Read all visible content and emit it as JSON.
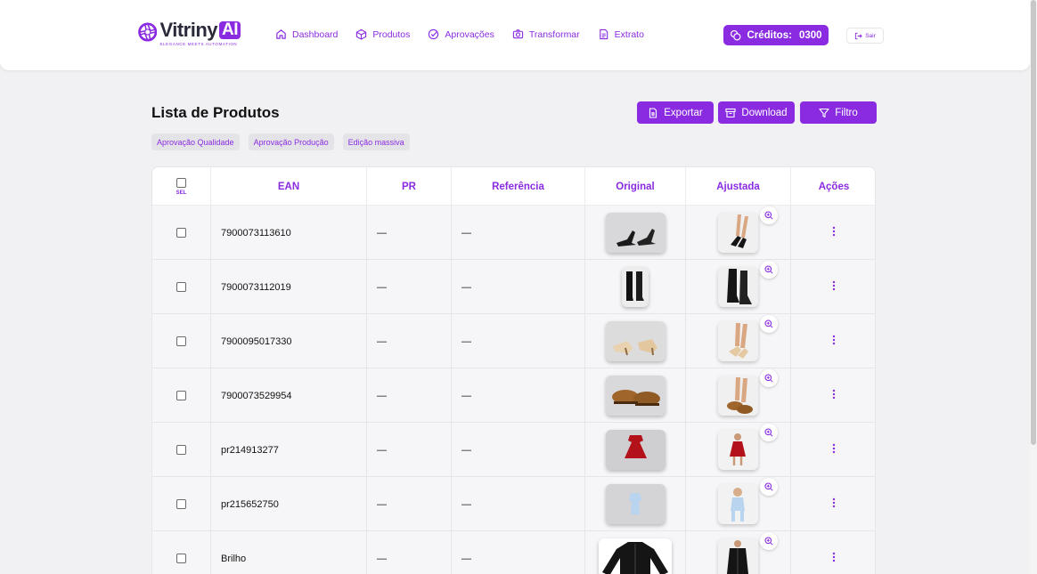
{
  "brand": {
    "word": "Vitriny",
    "ai": "AI",
    "tagline": "ELEGANCE MEETS AUTOMATION",
    "color": "#8a2be2"
  },
  "nav": [
    {
      "label": "Dashboard",
      "icon": "home-icon"
    },
    {
      "label": "Produtos",
      "icon": "box-icon"
    },
    {
      "label": "Aprovações",
      "icon": "check-circle-icon"
    },
    {
      "label": "Transformar",
      "icon": "camera-icon"
    },
    {
      "label": "Extrato",
      "icon": "document-icon"
    }
  ],
  "credits": {
    "label": "Créditos:",
    "value": "0300"
  },
  "logout": {
    "label": "Sair"
  },
  "page": {
    "title": "Lista de Produtos",
    "actions": {
      "export": "Exportar",
      "download": "Download",
      "filter": "Filtro"
    },
    "chips": [
      "Aprovação Qualidade",
      "Aprovação Produção",
      "Edição massiva"
    ]
  },
  "table": {
    "columns": {
      "sel": "SEL",
      "ean": "EAN",
      "pr": "PR",
      "ref": "Referência",
      "original": "Original",
      "adjusted": "Ajustada",
      "actions": "Ações"
    },
    "rows": [
      {
        "ean": "7900073113610",
        "pr": "—",
        "ref": "—",
        "product": "black-heeled-sandals"
      },
      {
        "ean": "7900073112019",
        "pr": "—",
        "ref": "—",
        "product": "black-boots"
      },
      {
        "ean": "7900095017330",
        "pr": "—",
        "ref": "—",
        "product": "beige-sandals"
      },
      {
        "ean": "7900073529954",
        "pr": "—",
        "ref": "—",
        "product": "brown-loafers"
      },
      {
        "ean": "pr214913277",
        "pr": "—",
        "ref": "—",
        "product": "red-dress"
      },
      {
        "ean": "pr215652750",
        "pr": "—",
        "ref": "—",
        "product": "light-blue-baby-clothes"
      },
      {
        "ean": "Brilho",
        "pr": "—",
        "ref": "—",
        "product": "black-jacket"
      }
    ]
  }
}
